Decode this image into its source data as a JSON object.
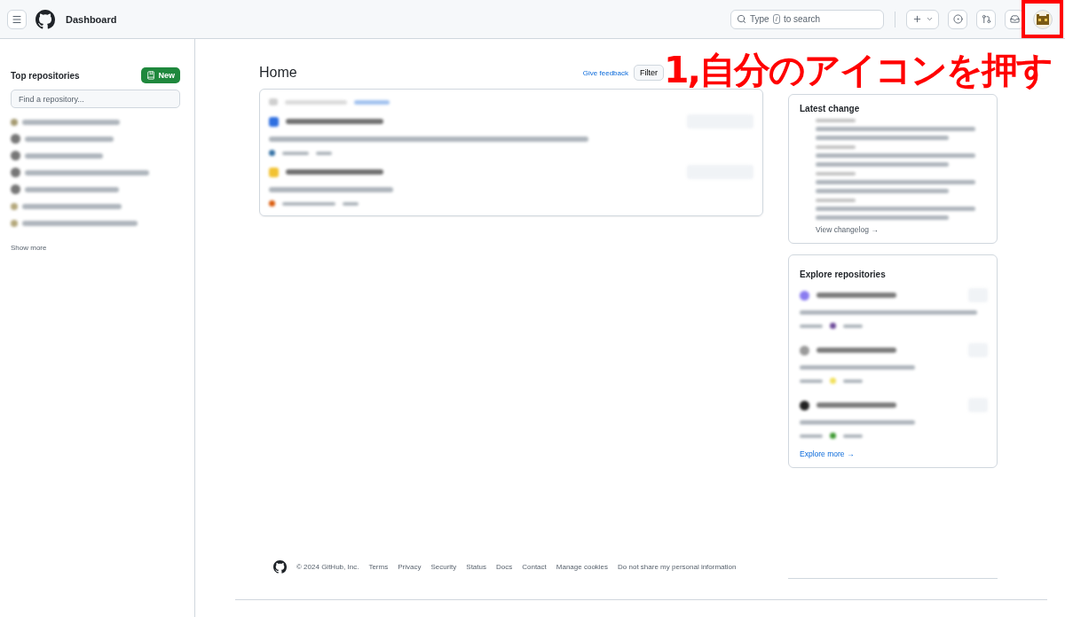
{
  "header": {
    "title": "Dashboard",
    "search": {
      "placeholder_before": "Type",
      "key": "/",
      "placeholder_after": "to search"
    }
  },
  "sidebar": {
    "title": "Top repositories",
    "new_button": "New",
    "search": {
      "placeholder": "Find a repository..."
    },
    "show_more": "Show more"
  },
  "home": {
    "title": "Home",
    "feedback": "Give feedback",
    "filter": "Filter",
    "cards": [
      {
        "color": "#2f6fe0"
      },
      {
        "color": "#f2c230"
      }
    ]
  },
  "latest_changes": {
    "title": "Latest change",
    "link": "View changelog →"
  },
  "explore": {
    "title": "Explore repositories",
    "repos": [
      {
        "color": "#8a7cf0"
      },
      {
        "color": "#9a9a9a"
      },
      {
        "color": "#222222"
      }
    ],
    "link": "Explore more →"
  },
  "footer": {
    "copyright": "© 2024 GitHub, Inc.",
    "links": [
      "Terms",
      "Privacy",
      "Security",
      "Status",
      "Docs",
      "Contact",
      "Manage cookies",
      "Do not share my personal information"
    ]
  },
  "annotation": {
    "text": "1,自分のアイコンを押す"
  }
}
